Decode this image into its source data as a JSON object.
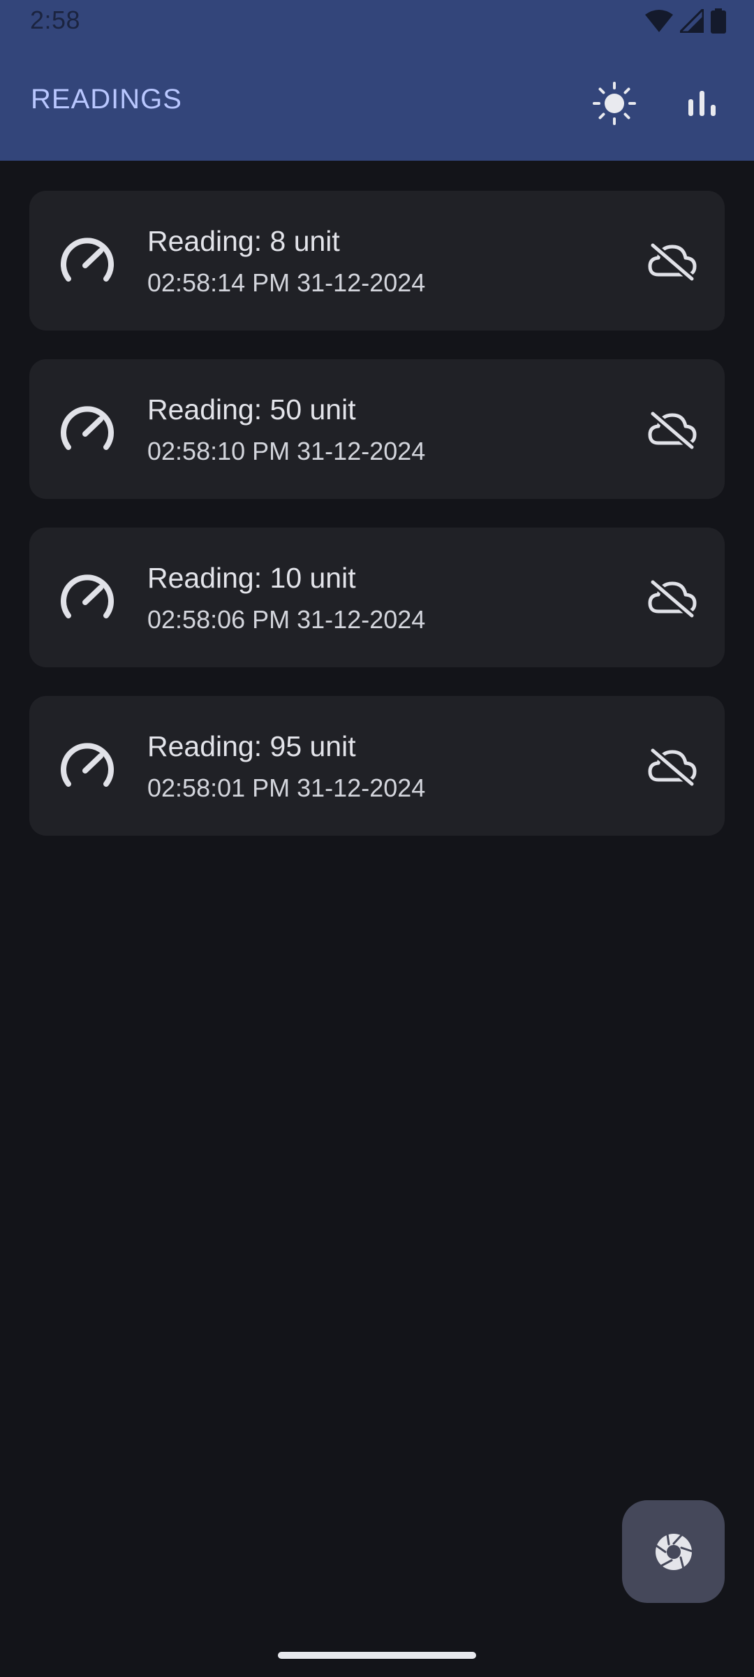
{
  "status_bar": {
    "time": "2:58",
    "icons": [
      "wifi-icon",
      "signal-icon",
      "battery-icon"
    ]
  },
  "app_bar": {
    "title": "READINGS",
    "actions": [
      {
        "icon": "sun-icon",
        "label": "Toggle theme"
      },
      {
        "icon": "bar-chart-icon",
        "label": "Statistics"
      }
    ]
  },
  "readings": [
    {
      "title": "Reading: 8 unit",
      "timestamp": "02:58:14 PM 31-12-2024",
      "leading_icon": "gauge-icon",
      "trailing_icon": "cloud-off-icon"
    },
    {
      "title": "Reading: 50 unit",
      "timestamp": "02:58:10 PM 31-12-2024",
      "leading_icon": "gauge-icon",
      "trailing_icon": "cloud-off-icon"
    },
    {
      "title": "Reading: 10 unit",
      "timestamp": "02:58:06 PM 31-12-2024",
      "leading_icon": "gauge-icon",
      "trailing_icon": "cloud-off-icon"
    },
    {
      "title": "Reading: 95 unit",
      "timestamp": "02:58:01 PM 31-12-2024",
      "leading_icon": "gauge-icon",
      "trailing_icon": "cloud-off-icon"
    }
  ],
  "fab": {
    "icon": "camera-shutter-icon"
  },
  "colors": {
    "app_bar": "#33457a",
    "title": "#b9c7ff",
    "background": "#131419",
    "card": "#202126",
    "fab": "#45485a"
  }
}
